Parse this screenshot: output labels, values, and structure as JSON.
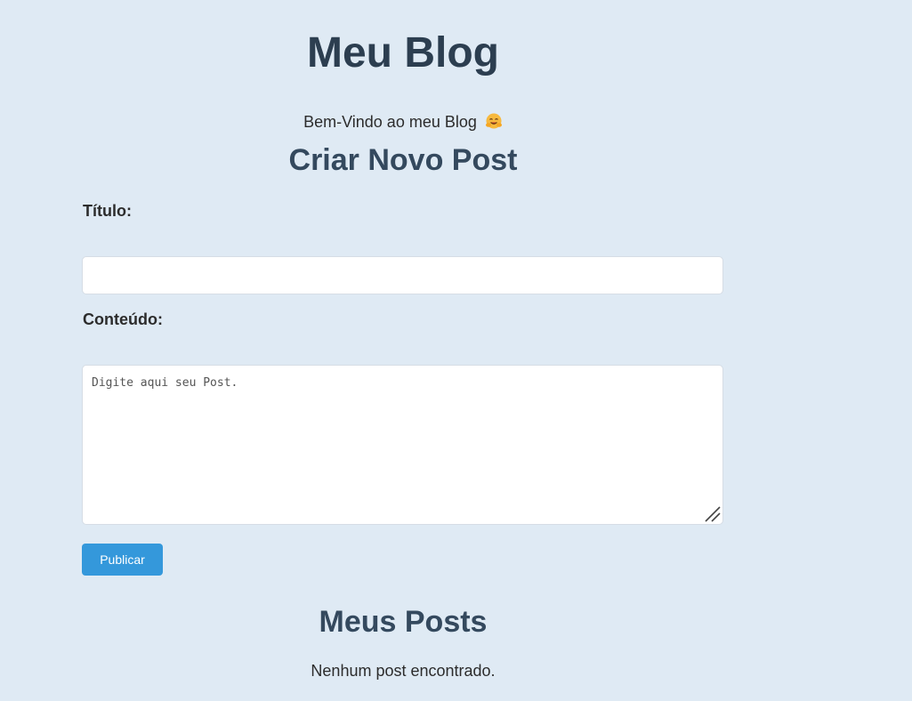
{
  "header": {
    "title": "Meu Blog",
    "welcome_text": "Bem-Vindo ao meu Blog",
    "welcome_icon": "hugging-face-emoji-icon"
  },
  "create_post": {
    "heading": "Criar Novo Post",
    "title_label": "Título:",
    "title_value": "",
    "content_label": "Conteúdo:",
    "content_placeholder": "Digite aqui seu Post.",
    "publish_label": "Publicar"
  },
  "posts": {
    "heading": "Meus Posts",
    "empty_message": "Nenhum post encontrado."
  },
  "colors": {
    "background": "#dfeaf4",
    "heading": "#2c3e50",
    "accent": "#3498db"
  }
}
